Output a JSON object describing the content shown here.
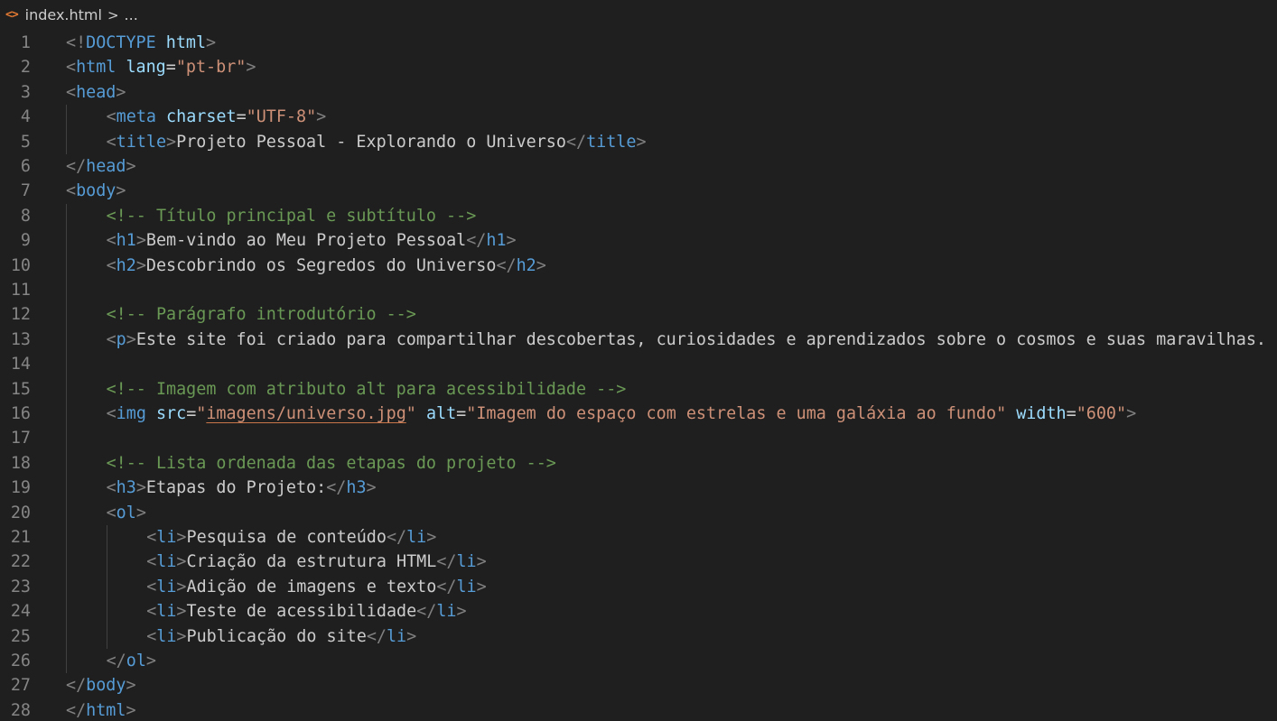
{
  "breadcrumb": {
    "file_icon": "<>",
    "file_name": "index.html",
    "separator": ">",
    "rest": "..."
  },
  "colors": {
    "background": "#1f1f1f",
    "punctuation": "#808080",
    "tag": "#569cd6",
    "attribute": "#9cdcfe",
    "string": "#ce9178",
    "comment": "#6a9955",
    "text": "#cccccc",
    "line_number": "#858585"
  },
  "lines": [
    {
      "n": "1",
      "indent": 0,
      "tokens": [
        [
          "p",
          "<!"
        ],
        [
          "t",
          "DOCTYPE"
        ],
        [
          "x",
          " "
        ],
        [
          "a",
          "html"
        ],
        [
          "p",
          ">"
        ]
      ]
    },
    {
      "n": "2",
      "indent": 0,
      "tokens": [
        [
          "p",
          "<"
        ],
        [
          "t",
          "html"
        ],
        [
          "x",
          " "
        ],
        [
          "a",
          "lang"
        ],
        [
          "x",
          "="
        ],
        [
          "s",
          "\"pt-br\""
        ],
        [
          "p",
          ">"
        ]
      ]
    },
    {
      "n": "3",
      "indent": 0,
      "tokens": [
        [
          "p",
          "<"
        ],
        [
          "t",
          "head"
        ],
        [
          "p",
          ">"
        ]
      ]
    },
    {
      "n": "4",
      "indent": 1,
      "tokens": [
        [
          "p",
          "<"
        ],
        [
          "t",
          "meta"
        ],
        [
          "x",
          " "
        ],
        [
          "a",
          "charset"
        ],
        [
          "x",
          "="
        ],
        [
          "s",
          "\"UTF-8\""
        ],
        [
          "p",
          ">"
        ]
      ]
    },
    {
      "n": "5",
      "indent": 1,
      "tokens": [
        [
          "p",
          "<"
        ],
        [
          "t",
          "title"
        ],
        [
          "p",
          ">"
        ],
        [
          "x",
          "Projeto Pessoal - Explorando o Universo"
        ],
        [
          "p",
          "</"
        ],
        [
          "t",
          "title"
        ],
        [
          "p",
          ">"
        ]
      ]
    },
    {
      "n": "6",
      "indent": 0,
      "tokens": [
        [
          "p",
          "</"
        ],
        [
          "t",
          "head"
        ],
        [
          "p",
          ">"
        ]
      ]
    },
    {
      "n": "7",
      "indent": 0,
      "tokens": [
        [
          "p",
          "<"
        ],
        [
          "t",
          "body"
        ],
        [
          "p",
          ">"
        ]
      ]
    },
    {
      "n": "8",
      "indent": 1,
      "tokens": [
        [
          "c",
          "<!-- Título principal e subtítulo -->"
        ]
      ]
    },
    {
      "n": "9",
      "indent": 1,
      "tokens": [
        [
          "p",
          "<"
        ],
        [
          "t",
          "h1"
        ],
        [
          "p",
          ">"
        ],
        [
          "x",
          "Bem-vindo ao Meu Projeto Pessoal"
        ],
        [
          "p",
          "</"
        ],
        [
          "t",
          "h1"
        ],
        [
          "p",
          ">"
        ]
      ]
    },
    {
      "n": "10",
      "indent": 1,
      "tokens": [
        [
          "p",
          "<"
        ],
        [
          "t",
          "h2"
        ],
        [
          "p",
          ">"
        ],
        [
          "x",
          "Descobrindo os Segredos do Universo"
        ],
        [
          "p",
          "</"
        ],
        [
          "t",
          "h2"
        ],
        [
          "p",
          ">"
        ]
      ]
    },
    {
      "n": "11",
      "indent": 1,
      "tokens": []
    },
    {
      "n": "12",
      "indent": 1,
      "tokens": [
        [
          "c",
          "<!-- Parágrafo introdutório -->"
        ]
      ]
    },
    {
      "n": "13",
      "indent": 1,
      "tokens": [
        [
          "p",
          "<"
        ],
        [
          "t",
          "p"
        ],
        [
          "p",
          ">"
        ],
        [
          "x",
          "Este site foi criado para compartilhar descobertas, curiosidades e aprendizados sobre o cosmos e suas maravilhas."
        ]
      ]
    },
    {
      "n": "14",
      "indent": 1,
      "tokens": []
    },
    {
      "n": "15",
      "indent": 1,
      "tokens": [
        [
          "c",
          "<!-- Imagem com atributo alt para acessibilidade -->"
        ]
      ]
    },
    {
      "n": "16",
      "indent": 1,
      "tokens": [
        [
          "p",
          "<"
        ],
        [
          "t",
          "img"
        ],
        [
          "x",
          " "
        ],
        [
          "a",
          "src"
        ],
        [
          "x",
          "="
        ],
        [
          "s",
          "\""
        ],
        [
          "su",
          "imagens/universo.jpg"
        ],
        [
          "s",
          "\""
        ],
        [
          "x",
          " "
        ],
        [
          "a",
          "alt"
        ],
        [
          "x",
          "="
        ],
        [
          "s",
          "\"Imagem do espaço com estrelas e uma galáxia ao fundo\""
        ],
        [
          "x",
          " "
        ],
        [
          "a",
          "width"
        ],
        [
          "x",
          "="
        ],
        [
          "s",
          "\"600\""
        ],
        [
          "p",
          ">"
        ]
      ]
    },
    {
      "n": "17",
      "indent": 1,
      "tokens": []
    },
    {
      "n": "18",
      "indent": 1,
      "tokens": [
        [
          "c",
          "<!-- Lista ordenada das etapas do projeto -->"
        ]
      ]
    },
    {
      "n": "19",
      "indent": 1,
      "tokens": [
        [
          "p",
          "<"
        ],
        [
          "t",
          "h3"
        ],
        [
          "p",
          ">"
        ],
        [
          "x",
          "Etapas do Projeto:"
        ],
        [
          "p",
          "</"
        ],
        [
          "t",
          "h3"
        ],
        [
          "p",
          ">"
        ]
      ]
    },
    {
      "n": "20",
      "indent": 1,
      "tokens": [
        [
          "p",
          "<"
        ],
        [
          "t",
          "ol"
        ],
        [
          "p",
          ">"
        ]
      ]
    },
    {
      "n": "21",
      "indent": 2,
      "tokens": [
        [
          "p",
          "<"
        ],
        [
          "t",
          "li"
        ],
        [
          "p",
          ">"
        ],
        [
          "x",
          "Pesquisa de conteúdo"
        ],
        [
          "p",
          "</"
        ],
        [
          "t",
          "li"
        ],
        [
          "p",
          ">"
        ]
      ]
    },
    {
      "n": "22",
      "indent": 2,
      "tokens": [
        [
          "p",
          "<"
        ],
        [
          "t",
          "li"
        ],
        [
          "p",
          ">"
        ],
        [
          "x",
          "Criação da estrutura HTML"
        ],
        [
          "p",
          "</"
        ],
        [
          "t",
          "li"
        ],
        [
          "p",
          ">"
        ]
      ]
    },
    {
      "n": "23",
      "indent": 2,
      "tokens": [
        [
          "p",
          "<"
        ],
        [
          "t",
          "li"
        ],
        [
          "p",
          ">"
        ],
        [
          "x",
          "Adição de imagens e texto"
        ],
        [
          "p",
          "</"
        ],
        [
          "t",
          "li"
        ],
        [
          "p",
          ">"
        ]
      ]
    },
    {
      "n": "24",
      "indent": 2,
      "tokens": [
        [
          "p",
          "<"
        ],
        [
          "t",
          "li"
        ],
        [
          "p",
          ">"
        ],
        [
          "x",
          "Teste de acessibilidade"
        ],
        [
          "p",
          "</"
        ],
        [
          "t",
          "li"
        ],
        [
          "p",
          ">"
        ]
      ]
    },
    {
      "n": "25",
      "indent": 2,
      "tokens": [
        [
          "p",
          "<"
        ],
        [
          "t",
          "li"
        ],
        [
          "p",
          ">"
        ],
        [
          "x",
          "Publicação do site"
        ],
        [
          "p",
          "</"
        ],
        [
          "t",
          "li"
        ],
        [
          "p",
          ">"
        ]
      ]
    },
    {
      "n": "26",
      "indent": 1,
      "tokens": [
        [
          "p",
          "</"
        ],
        [
          "t",
          "ol"
        ],
        [
          "p",
          ">"
        ]
      ]
    },
    {
      "n": "27",
      "indent": 0,
      "tokens": [
        [
          "p",
          "</"
        ],
        [
          "t",
          "body"
        ],
        [
          "p",
          ">"
        ]
      ]
    },
    {
      "n": "28",
      "indent": 0,
      "tokens": [
        [
          "p",
          "</"
        ],
        [
          "t",
          "html"
        ],
        [
          "p",
          ">"
        ]
      ]
    }
  ]
}
